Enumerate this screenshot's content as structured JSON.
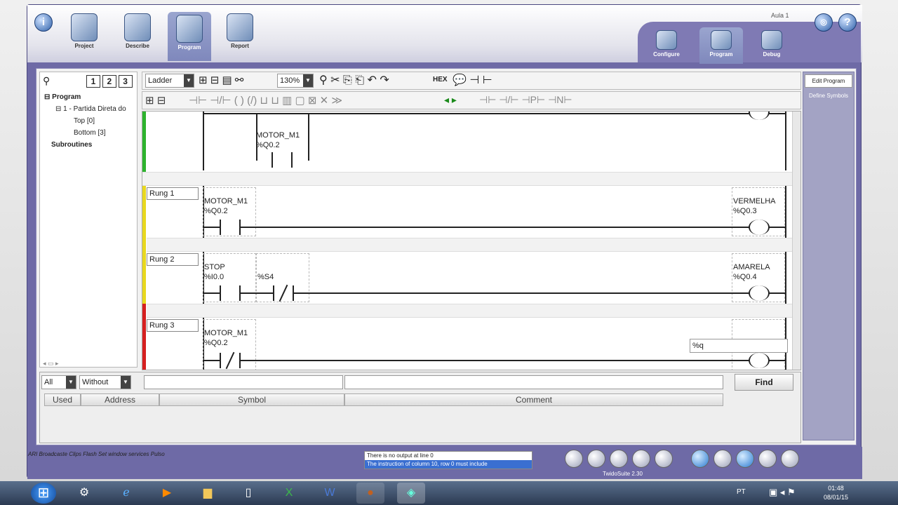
{
  "window": {
    "title": "Aula 1",
    "controls": {
      "min": "–",
      "max": "□",
      "close": "×"
    }
  },
  "nav_left": [
    {
      "label": "Project"
    },
    {
      "label": "Describe"
    },
    {
      "label": "Program"
    },
    {
      "label": "Report"
    }
  ],
  "nav_right": [
    {
      "label": "Configure"
    },
    {
      "label": "Program"
    },
    {
      "label": "Debug"
    }
  ],
  "tree": {
    "views": [
      "1",
      "2",
      "3"
    ],
    "items": [
      "Program",
      "1 - Partida Direta do",
      "Top [0]",
      "Bottom [3]",
      "Subroutines"
    ]
  },
  "toolbar": {
    "lang": "Ladder",
    "zoom": "130%",
    "hex": "HEX"
  },
  "ladder": {
    "rung0": {
      "contact_symbol": "MOTOR_M1",
      "contact_addr": "%Q0.2"
    },
    "rung1": {
      "label": "Rung 1",
      "c1_symbol": "MOTOR_M1",
      "c1_addr": "%Q0.2",
      "coil_symbol": "VERMELHA",
      "coil_addr": "%Q0.3"
    },
    "rung2": {
      "label": "Rung 2",
      "c1_symbol": "STOP",
      "c1_addr": "%I0.0",
      "c2_addr": "%S4",
      "coil_symbol": "AMARELA",
      "coil_addr": "%Q0.4"
    },
    "rung3": {
      "label": "Rung 3",
      "c1_symbol": "MOTOR_M1",
      "c1_addr": "%Q0.2",
      "edit_value": "%q"
    },
    "rung_colors": [
      "#2db32d",
      "#e8d81f",
      "#d62020"
    ]
  },
  "right_panel": {
    "edit": "Edit Program",
    "define": "Define Symbols"
  },
  "find": {
    "filter1": "All",
    "filter2": "Without",
    "button": "Find",
    "columns": [
      "Used",
      "Address",
      "Symbol",
      "Comment"
    ]
  },
  "messages": [
    "There is no output at line 0",
    "The instruction of column 10, row 0 must include"
  ],
  "status": {
    "version": "TwidoSuite 2.30"
  },
  "desktop_text": "ARI Broadcaste Clips Flash Set window services Pulso",
  "taskbar": {
    "lang": "PT",
    "time": "01:48",
    "date": "08/01/15"
  }
}
